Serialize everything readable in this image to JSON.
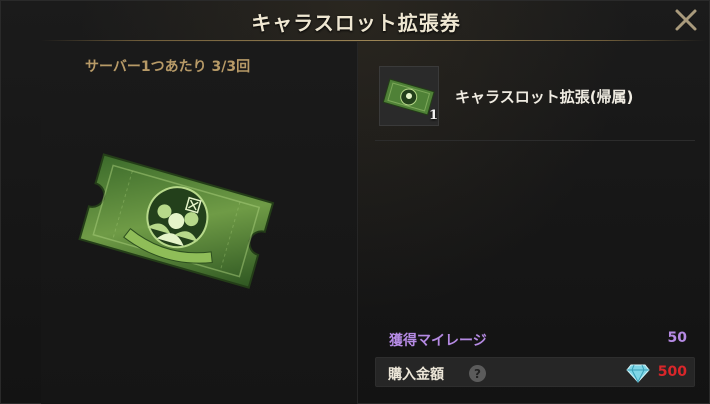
{
  "header": {
    "title": "キャラスロット拡張券",
    "close_icon": "close-x-icon"
  },
  "left": {
    "limit_text": "サーバー1つあたり 3/3回",
    "image_icon": "character-slot-ticket-icon"
  },
  "item": {
    "thumb_icon": "character-slot-ticket-icon",
    "count": "1",
    "name": "キャラスロット拡張(帰属)"
  },
  "mileage": {
    "label": "獲得マイレージ",
    "value": "50"
  },
  "price": {
    "label": "購入金額",
    "help_glyph": "?",
    "currency_icon": "diamond-gem-icon",
    "value": "500"
  },
  "colors": {
    "accent_gold": "#b79a67",
    "mileage_purple": "#b58ae3",
    "price_red": "#d9262a"
  }
}
